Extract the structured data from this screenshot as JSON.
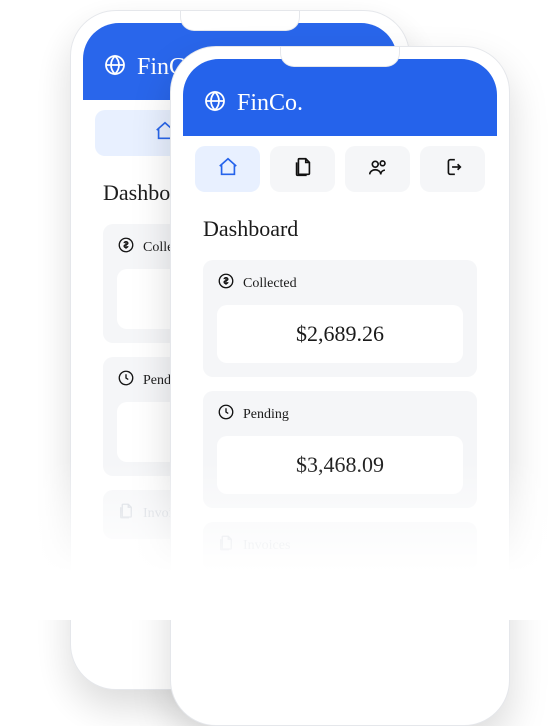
{
  "app": {
    "name": "FinCo."
  },
  "nav": {
    "items": [
      {
        "name": "home"
      },
      {
        "name": "documents"
      },
      {
        "name": "customers"
      },
      {
        "name": "logout"
      }
    ]
  },
  "page": {
    "title": "Dashboard"
  },
  "cards": {
    "collected": {
      "label": "Collected",
      "value": "$2,689.26"
    },
    "pending": {
      "label": "Pending",
      "value": "$3,468.09"
    },
    "invoices": {
      "label": "Invoices"
    }
  },
  "colors": {
    "brand": "#2563eb"
  }
}
